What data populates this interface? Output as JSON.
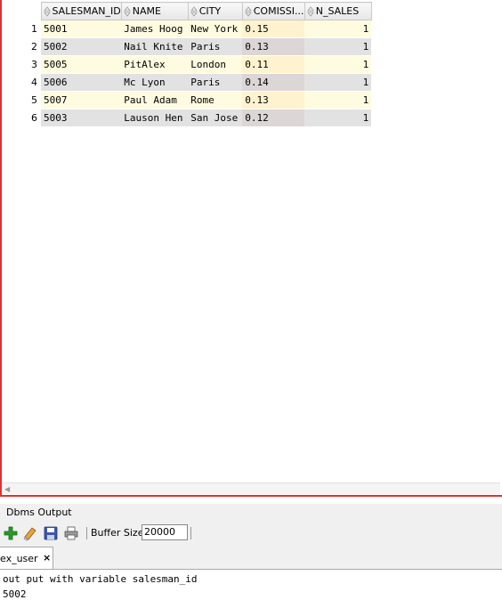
{
  "grid": {
    "columns": [
      "SALESMAN_ID",
      "NAME",
      "CITY",
      "COMISSI...",
      "N_SALES"
    ],
    "rows": [
      {
        "num": "1",
        "salesman_id": "5001",
        "name": "James Hoog",
        "city": "New York",
        "commission": "0.15",
        "n_sales": "1"
      },
      {
        "num": "2",
        "salesman_id": "5002",
        "name": "Nail Knite",
        "city": "Paris",
        "commission": "0.13",
        "n_sales": "1"
      },
      {
        "num": "3",
        "salesman_id": "5005",
        "name": "PitAlex",
        "city": "London",
        "commission": "0.11",
        "n_sales": "1"
      },
      {
        "num": "4",
        "salesman_id": "5006",
        "name": "Mc Lyon",
        "city": "Paris",
        "commission": "0.14",
        "n_sales": "1"
      },
      {
        "num": "5",
        "salesman_id": "5007",
        "name": "Paul Adam",
        "city": "Rome",
        "commission": "0.13",
        "n_sales": "1"
      },
      {
        "num": "6",
        "salesman_id": "5003",
        "name": "Lauson Hen",
        "city": "San Jose",
        "commission": "0.12",
        "n_sales": "1"
      }
    ]
  },
  "dbms_output": {
    "title": "Dbms Output",
    "buffer_label": "Buffer Size:",
    "buffer_value": "20000",
    "tab_label": "ex_user",
    "tab_close": "×",
    "output_lines": [
      "out put with variable salesman_id",
      "5002"
    ]
  },
  "icons": {
    "add": "plus-icon",
    "clear": "eraser-icon",
    "save": "save-icon",
    "print": "print-icon"
  },
  "colors": {
    "accent_red": "#d33333",
    "add_green": "#2a9a2a",
    "row_odd": "#fffbe0",
    "row_even": "#e2e2e2"
  }
}
